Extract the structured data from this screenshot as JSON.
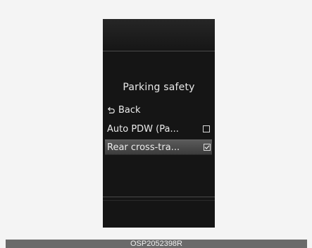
{
  "screen": {
    "title": "Parking safety",
    "menu": [
      {
        "label": "Back",
        "icon": "back-arrow-icon"
      },
      {
        "label": "Auto PDW (Pa...",
        "checked": false
      },
      {
        "label": "Rear cross-tra...",
        "checked": true,
        "selected": true
      }
    ]
  },
  "figure": {
    "caption": "OSP2052398R"
  },
  "colors": {
    "page_background": "#f4f4f4",
    "display_background": "#151515",
    "selected_row": "#4a4a4a",
    "text": "#ececec",
    "caption_bar": "#6a6a6a"
  }
}
